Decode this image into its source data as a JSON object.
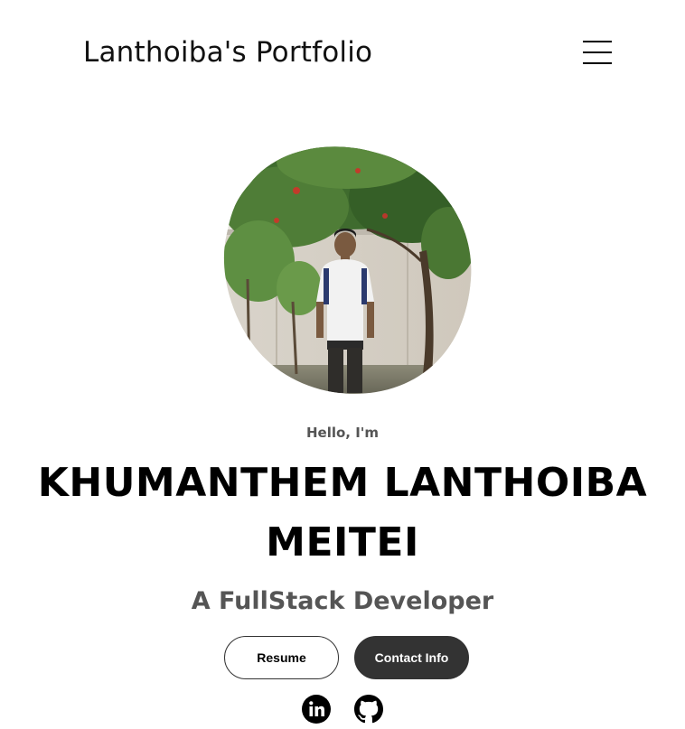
{
  "nav": {
    "logo": "Lanthoiba's Portfolio",
    "menu_icon": "hamburger-menu-icon"
  },
  "hero": {
    "photo_alt": "Profile picture",
    "greeting": "Hello, I'm",
    "name": "KHUMANTHEM LANTHOIBA MEITEI",
    "role": "A FullStack Developer",
    "buttons": {
      "resume": "Resume",
      "contact": "Contact Info"
    },
    "socials": [
      {
        "icon": "linkedin-icon",
        "label": "LinkedIn"
      },
      {
        "icon": "github-icon",
        "label": "GitHub"
      }
    ]
  },
  "colors": {
    "background": "#ffffff",
    "text": "#000000",
    "muted": "#555555",
    "dark_button": "#333333"
  }
}
